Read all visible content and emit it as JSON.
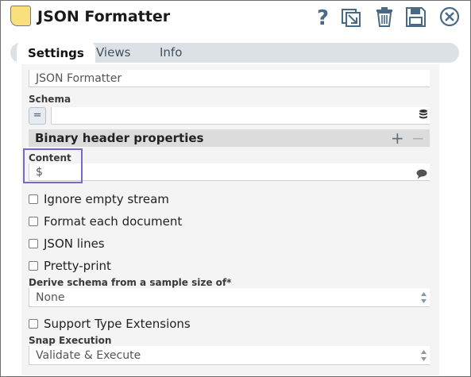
{
  "header": {
    "title": "JSON Formatter",
    "icons": [
      "help-icon",
      "export-icon",
      "trash-icon",
      "save-icon",
      "close-icon"
    ]
  },
  "tabs": [
    {
      "label": "Settings",
      "active": true
    },
    {
      "label": "Views",
      "active": false
    },
    {
      "label": "Info",
      "active": false
    }
  ],
  "settings": {
    "label_value": "JSON Formatter",
    "schema_label": "Schema",
    "schema_value": "",
    "section_title": "Binary header properties",
    "content_label": "Content",
    "content_value": "$",
    "ignore_empty_stream": "Ignore empty stream",
    "format_each_document": "Format each document",
    "json_lines": "JSON lines",
    "pretty_print": "Pretty-print",
    "derive_schema_label": "Derive schema from a sample size of*",
    "derive_schema_value": "None",
    "support_type_extensions": "Support Type Extensions",
    "snap_execution_label": "Snap Execution",
    "snap_execution_value": "Validate & Execute"
  },
  "colors": {
    "accent": "#7b67c9",
    "snap_icon": "#f9e07c",
    "icon_blue": "#496a86"
  }
}
